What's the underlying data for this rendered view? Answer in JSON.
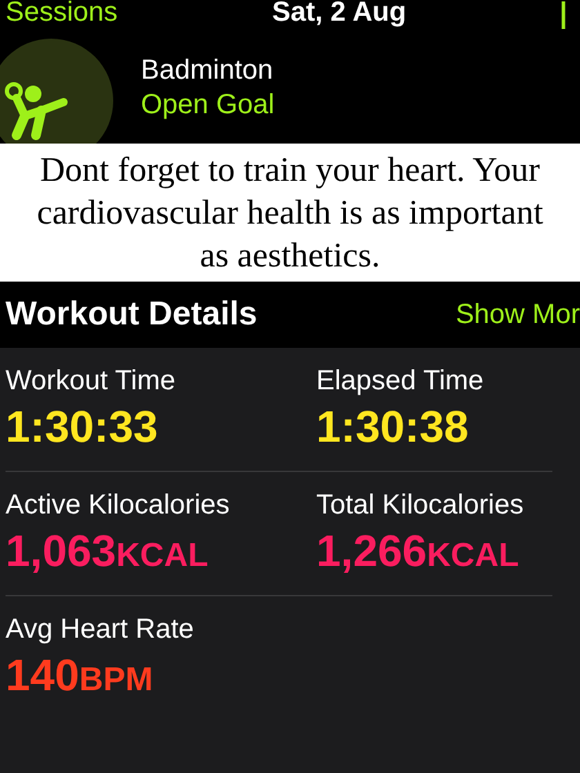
{
  "nav": {
    "back": "Sessions",
    "title": "Sat, 2 Aug"
  },
  "workout": {
    "name": "Badminton",
    "goal": "Open Goal"
  },
  "caption": "Dont forget to train your heart. Your cardiovascular health is as important as aesthetics.",
  "details": {
    "title": "Workout Details",
    "action": "Show Mor",
    "metrics": [
      {
        "label": "Workout Time",
        "value": "1:30:33",
        "color": "#ffe620"
      },
      {
        "label": "Elapsed Time",
        "value": "1:30:38",
        "color": "#ffe620"
      },
      {
        "label": "Active Kilocalories",
        "value": "1,063",
        "unit": "KCAL",
        "color": "#fa1d5f"
      },
      {
        "label": "Total Kilocalories",
        "value": "1,266",
        "unit": "KCAL",
        "color": "#fa1d5f"
      },
      {
        "label": "Avg Heart Rate",
        "value": "140",
        "unit": "BPM",
        "color": "#ff3b1e"
      }
    ]
  }
}
